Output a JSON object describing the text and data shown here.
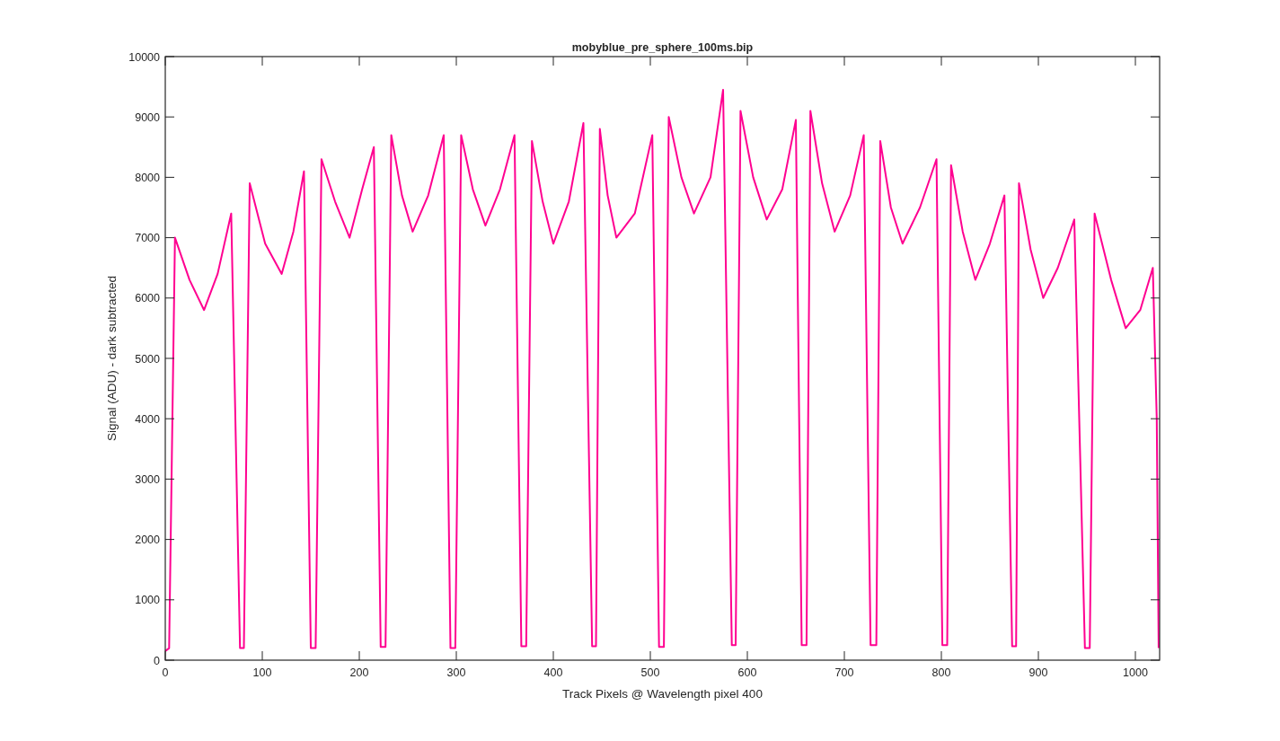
{
  "figure": {
    "chart_data": {
      "type": "line",
      "title": "mobyblue_pre_sphere_100ms.bip",
      "xlabel": "Track Pixels @ Wavelength pixel 400",
      "ylabel": "Signal (ADU) - dark subtracted",
      "xlim": [
        0,
        1025
      ],
      "ylim": [
        0,
        10000
      ],
      "xticks": [
        0,
        100,
        200,
        300,
        400,
        500,
        600,
        700,
        800,
        900,
        1000
      ],
      "yticks": [
        0,
        1000,
        2000,
        3000,
        4000,
        5000,
        6000,
        7000,
        8000,
        9000,
        10000
      ],
      "x": [
        0,
        4,
        10,
        25,
        40,
        54,
        68,
        77,
        81,
        87,
        103,
        120,
        132,
        143,
        150,
        155,
        161,
        175,
        190,
        203,
        215,
        222,
        227,
        233,
        244,
        255,
        271,
        287,
        294,
        299,
        305,
        317,
        330,
        345,
        360,
        367,
        372,
        378,
        389,
        400,
        416,
        431,
        440,
        444,
        448,
        456,
        465,
        484,
        502,
        509,
        514,
        519,
        532,
        545,
        562,
        575,
        584,
        588,
        593,
        606,
        620,
        636,
        650,
        656,
        661,
        665,
        677,
        690,
        706,
        720,
        727,
        733,
        737,
        748,
        760,
        778,
        795,
        801,
        806,
        810,
        822,
        835,
        850,
        865,
        873,
        877,
        880,
        892,
        905,
        920,
        937,
        948,
        953,
        958,
        975,
        990,
        1005,
        1018,
        1022,
        1024
      ],
      "series": [
        {
          "color": "#ff0090",
          "values": [
            150,
            200,
            7000,
            6300,
            5800,
            6400,
            7400,
            200,
            200,
            7900,
            6900,
            6400,
            7100,
            8100,
            200,
            200,
            8300,
            7600,
            7000,
            7800,
            8500,
            220,
            220,
            8700,
            7700,
            7100,
            7700,
            8700,
            200,
            200,
            8700,
            7800,
            7200,
            7800,
            8700,
            230,
            230,
            8600,
            7600,
            6900,
            7600,
            8900,
            230,
            230,
            8800,
            7700,
            7000,
            7400,
            8700,
            220,
            220,
            9000,
            8000,
            7400,
            8000,
            9450,
            250,
            250,
            9100,
            8000,
            7300,
            7800,
            8950,
            250,
            250,
            9100,
            7900,
            7100,
            7700,
            8700,
            250,
            250,
            8600,
            7500,
            6900,
            7500,
            8300,
            250,
            250,
            8200,
            7100,
            6300,
            6900,
            7700,
            230,
            230,
            7900,
            6800,
            6000,
            6500,
            7300,
            200,
            200,
            7400,
            6300,
            5500,
            5800,
            6500,
            4000,
            200
          ]
        }
      ]
    }
  }
}
